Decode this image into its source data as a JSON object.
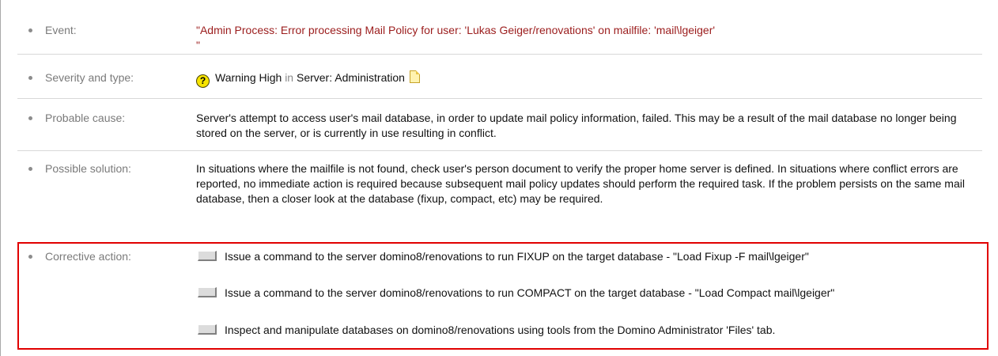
{
  "event": {
    "label": "Event:",
    "value": "\"Admin Process: Error processing Mail Policy for user: 'Lukas Geiger/renovations' on mailfile: 'mail\\lgeiger'\n\""
  },
  "severity": {
    "label": "Severity and type:",
    "icon": "help-icon",
    "icon_glyph": "?",
    "level": "Warning High",
    "in_word": "in",
    "category": "Server: Administration",
    "doc_icon": "document-icon"
  },
  "probable_cause": {
    "label": "Probable cause:",
    "value": "Server's attempt to access user's mail database, in order to update mail policy information, failed.  This may be a result of the mail database no longer being stored on the server, or is currently in use resulting in conflict."
  },
  "possible_solution": {
    "label": "Possible solution:",
    "value": "In situations where the mailfile is not found, check user's person document to verify the proper home server is defined.  In situations where conflict errors are reported, no immediate action is required because subsequent mail policy updates should perform the required task.   If the problem persists on the same mail database, then a closer look at the database (fixup, compact, etc) may be required."
  },
  "corrective_action": {
    "label": "Corrective action:",
    "items": [
      {
        "text": "Issue a command to the server domino8/renovations to run FIXUP on the target database - \"Load Fixup -F mail\\lgeiger\""
      },
      {
        "text": "Issue a command to the server domino8/renovations to run COMPACT on the target database - \"Load Compact mail\\lgeiger\""
      },
      {
        "text": "Inspect and manipulate databases on domino8/renovations using tools from the Domino Administrator 'Files' tab."
      }
    ]
  },
  "colors": {
    "event_text": "#9b1c1c",
    "label_text": "#7a7a7a",
    "highlight_border": "#e10000",
    "warning_icon": "#f7e400"
  }
}
